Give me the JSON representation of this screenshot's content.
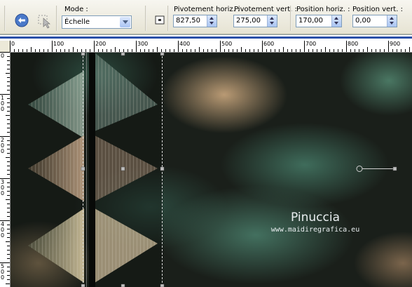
{
  "toolbar": {
    "mode": {
      "label": "Mode :",
      "value": "Échelle"
    },
    "fields": [
      {
        "label": "Pivotement horiz. :",
        "value": "827,50"
      },
      {
        "label": "Pivotement vert. :",
        "value": "275,00"
      },
      {
        "label": "Position horiz. :",
        "value": "170,00"
      },
      {
        "label": "Position vert. :",
        "value": "0,00"
      }
    ]
  },
  "ruler_h": {
    "ticks": [
      "0",
      "100",
      "200",
      "300",
      "400",
      "500",
      "600",
      "700",
      "800",
      "900"
    ]
  },
  "ruler_v": {
    "ticks": [
      "0",
      "1\n0\n0",
      "2\n0\n0",
      "3\n0\n0",
      "4\n0\n0",
      "5\n0\n0"
    ]
  },
  "watermark": {
    "name": "Pinuccia",
    "url": "www.maidiregrafica.eu"
  },
  "colors": {
    "ruler_accent": "#2a4fa8",
    "canvas_bg": "#1a1f1a"
  }
}
